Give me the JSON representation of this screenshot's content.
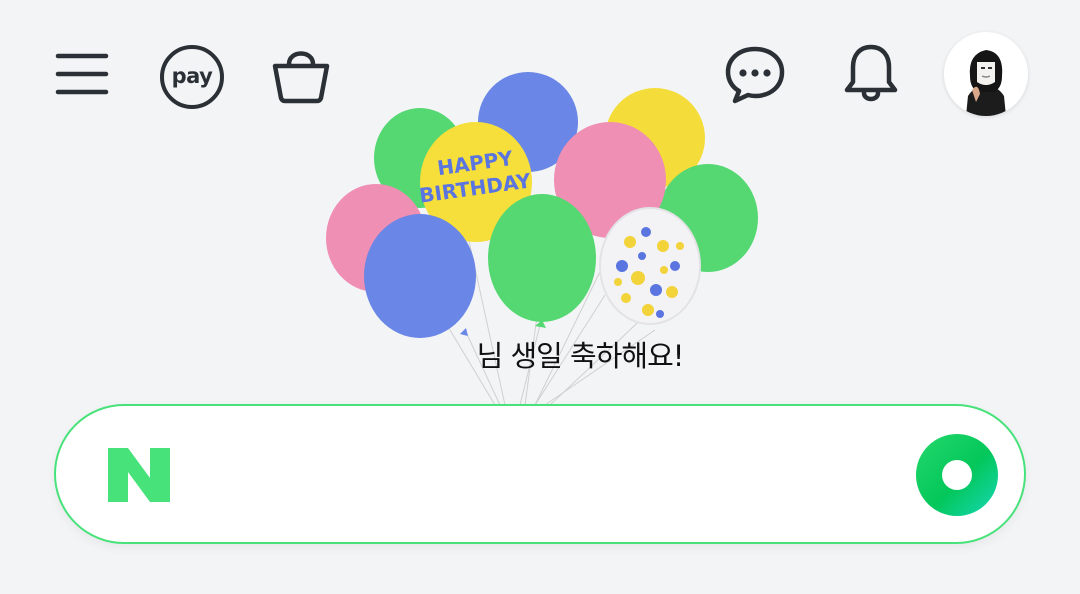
{
  "header": {
    "menu_icon": "hamburger-menu-icon",
    "pay_label": "pay",
    "shopping_icon": "shopping-bag-icon",
    "talk_icon": "chat-bubble-icon",
    "notification_icon": "bell-icon",
    "profile_icon": "profile-avatar"
  },
  "banner": {
    "message": "님 생일 축하해요!",
    "balloon_text_line1": "HAPPY",
    "balloon_text_line2": "BIRTHDAY"
  },
  "search": {
    "logo_icon": "naver-n-logo",
    "value": "",
    "placeholder": "",
    "submit_icon": "search-green-circle-icon"
  },
  "colors": {
    "background": "#f3f4f6",
    "icon": "#2b2f36",
    "brand_green": "#03c75a",
    "search_border": "#48e27a"
  }
}
